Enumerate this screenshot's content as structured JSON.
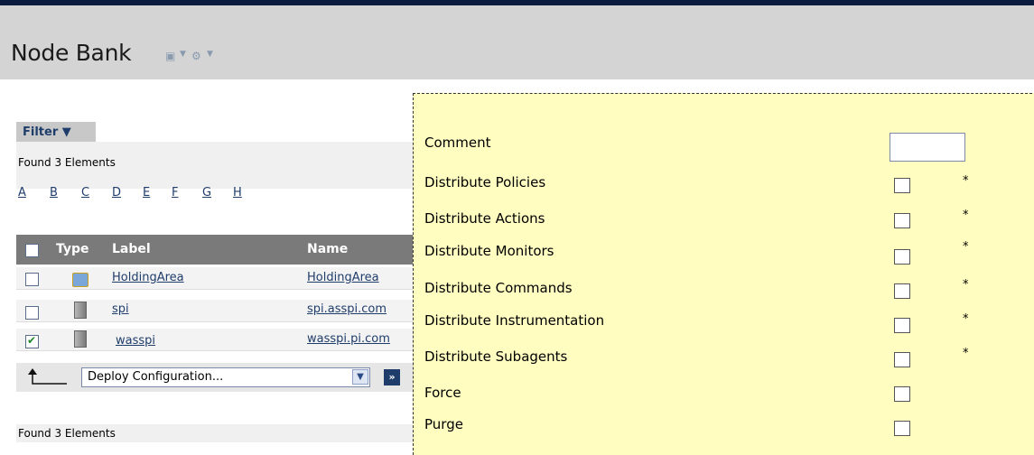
{
  "header": {
    "title": "Node Bank",
    "icons": [
      "window-icon",
      "gear-icon"
    ]
  },
  "filter": {
    "label": "Filter ▼"
  },
  "list": {
    "found_top": "Found 3 Elements",
    "found_bottom": "Found 3 Elements",
    "letters": [
      "A",
      "B",
      "C",
      "D",
      "E",
      "F",
      "G",
      "H"
    ],
    "columns": {
      "type": "Type",
      "label": "Label",
      "name": "Name"
    },
    "rows": [
      {
        "label": "HoldingArea",
        "name": "HoldingArea",
        "checked": false,
        "icon": "folder-icon"
      },
      {
        "label": "spi",
        "name": "spi.asspi.com",
        "checked": false,
        "icon": "server-icon"
      },
      {
        "label": "wasspi",
        "name": "wasspi.pi.com",
        "checked": true,
        "icon": "server-icon"
      }
    ]
  },
  "actions": {
    "selected": "Deploy Configuration...",
    "go": "»"
  },
  "panel": {
    "fields": [
      {
        "label": "Comment",
        "kind": "input",
        "value": ""
      },
      {
        "label": "Distribute Policies",
        "kind": "checkbox",
        "star": "*"
      },
      {
        "label": "Distribute Actions",
        "kind": "checkbox",
        "star": "*"
      },
      {
        "label": "Distribute Monitors",
        "kind": "checkbox",
        "star": "*"
      },
      {
        "label": "Distribute Commands",
        "kind": "checkbox",
        "star": "*"
      },
      {
        "label": "Distribute Instrumentation",
        "kind": "checkbox",
        "star": "*"
      },
      {
        "label": "Distribute Subagents",
        "kind": "checkbox",
        "star": "*"
      },
      {
        "label": "Force",
        "kind": "checkbox",
        "star": ""
      },
      {
        "label": "Purge",
        "kind": "checkbox",
        "star": ""
      }
    ]
  }
}
